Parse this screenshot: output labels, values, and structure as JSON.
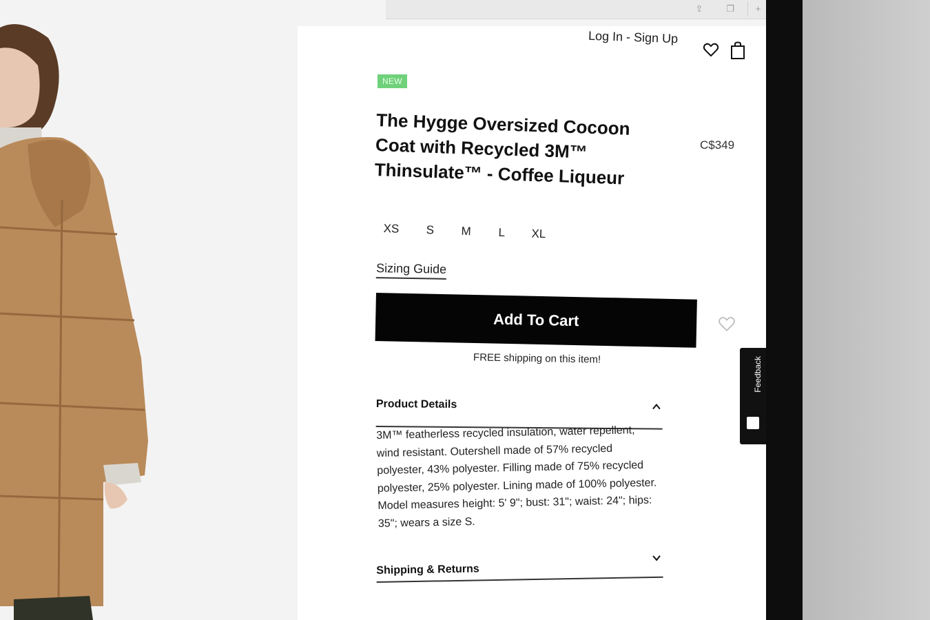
{
  "header": {
    "auth_links": "Log In - Sign Up",
    "wishlist_icon": "heart-icon",
    "bag_icon": "shopping-bag-icon"
  },
  "product": {
    "badge": "NEW",
    "title": "The Hygge Oversized Cocoon Coat with Recycled 3M™ Thinsulate™ - Coffee Liqueur",
    "price": "C$349",
    "sizes": [
      "XS",
      "S",
      "M",
      "L",
      "XL"
    ],
    "sizing_guide": "Sizing Guide",
    "add_to_cart": "Add To Cart",
    "free_shipping": "FREE shipping on this item!"
  },
  "accordion": {
    "product_details": {
      "title": "Product Details",
      "expanded": true,
      "body": "3M™ featherless recycled insulation, water repellent, wind resistant. Outershell made of 57% recycled polyester, 43% polyester. Filling made of 75% recycled polyester, 25% polyester. Lining made of 100% polyester. Model measures height: 5' 9\"; bust: 31\"; waist: 24\"; hips: 35\"; wears a size S."
    },
    "shipping_returns": {
      "title": "Shipping & Returns",
      "expanded": false
    }
  },
  "feedback": {
    "label": "Feedback"
  },
  "colors": {
    "badge_green": "#6fd17a",
    "button_black": "#050505",
    "coat_tan": "#b98a5a"
  }
}
